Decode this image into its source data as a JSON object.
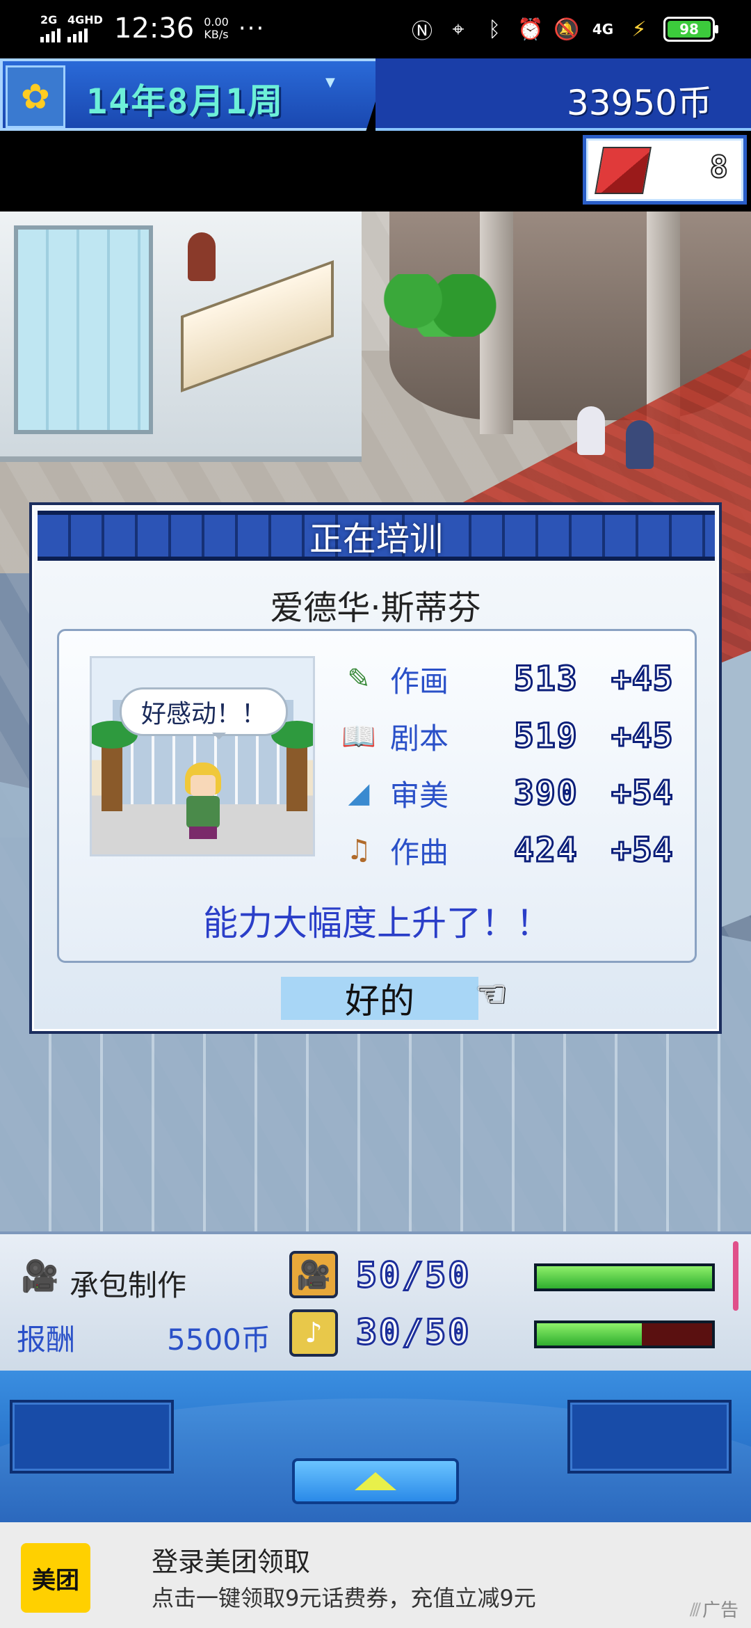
{
  "status_bar": {
    "net1": "2G",
    "net2": "4GHD",
    "time": "12:36",
    "speed_value": "0.00",
    "speed_unit": "KB/s",
    "more": "···",
    "net3": "4G",
    "battery": "98"
  },
  "header": {
    "date": "14年8月1周",
    "money": "33950币",
    "item_count": "8"
  },
  "dialog": {
    "title": "正在培训",
    "name": "爱德华·斯蒂芬",
    "speech": "好感动！！",
    "stats": [
      {
        "label": "作画",
        "value": "513",
        "inc": "+45",
        "icon": "pencil-icon"
      },
      {
        "label": "剧本",
        "value": "519",
        "inc": "+45",
        "icon": "book-icon"
      },
      {
        "label": "审美",
        "value": "390",
        "inc": "+54",
        "icon": "fan-icon"
      },
      {
        "label": "作曲",
        "value": "424",
        "inc": "+54",
        "icon": "guitar-icon"
      }
    ],
    "result": "能力大幅度上升了！！",
    "ok": "好的"
  },
  "production": {
    "label": "承包制作",
    "reward_label": "报酬",
    "reward_value": "5500币",
    "resources": [
      {
        "icon": "film-camera-icon",
        "value": "50/50",
        "level": 1.0
      },
      {
        "icon": "music-note-icon",
        "value": "30/50",
        "level": 0.6
      }
    ]
  },
  "ad": {
    "logo": "美团",
    "title": "登录美团领取",
    "subtitle": "点击一键领取9元话费券，充值立减9元",
    "tag": "广告"
  },
  "colors": {
    "accent_blue": "#2a50c8",
    "header_blue": "#1a48b0",
    "bar_green": "#2fae2f",
    "ad_yellow": "#ffd000"
  }
}
